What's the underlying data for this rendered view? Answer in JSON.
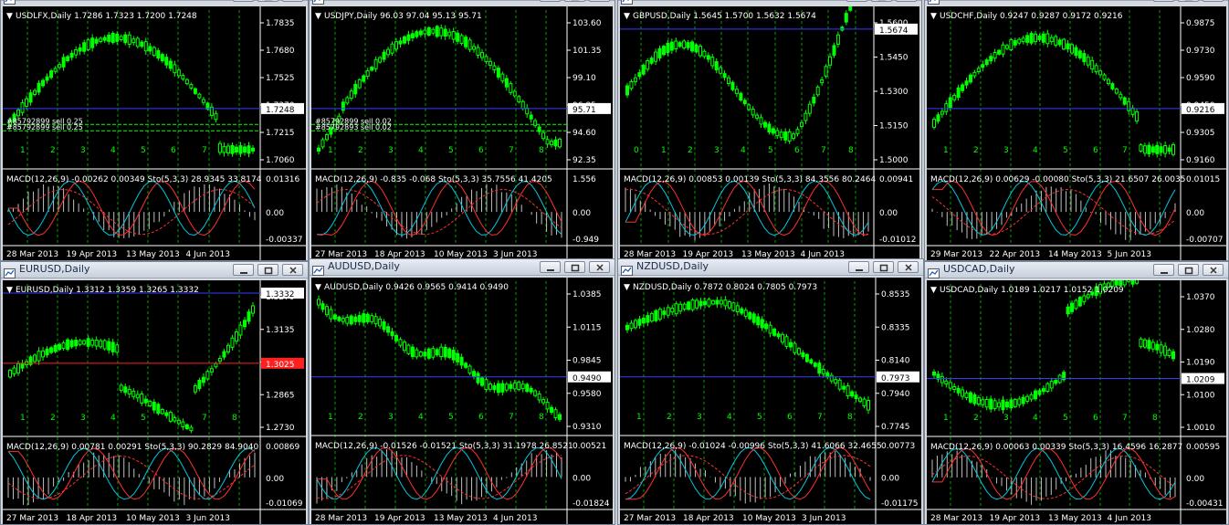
{
  "windows": [
    {
      "id": "usdlfx",
      "title": "USDLFX,Daily",
      "header": "USDLFX,Daily  1.7286 1.7323 1.7200 1.7248",
      "price_ticks": [
        "1.7835",
        "1.7680",
        "1.7525",
        "1.7370",
        "1.7215",
        "1.7060"
      ],
      "current_price": "1.7248",
      "order_lines": [
        "#85792899 sell 0.25",
        "#85792899 sell 0.25"
      ],
      "indicator_header": "MACD(12,26,9) -0.00262 0.00349  Sto(5,3,3) 28.9345 33.8174",
      "indicator_ticks": [
        "0.01316",
        "0.00",
        "-0.00337"
      ],
      "date_labels": [
        "28 Mar 2013",
        "19 Apr 2013",
        "13 May 2013",
        "4 Jun 2013"
      ],
      "week_labels": [
        "1",
        "2",
        "3",
        "4",
        "5",
        "6",
        "7",
        "8"
      ],
      "shape": "humpmid",
      "show_titlebar": false
    },
    {
      "id": "usdjpy",
      "title": "USDJPY,Daily",
      "header": "USDJPY,Daily  96.03 97.04 95.13 95.71",
      "price_ticks": [
        "103.60",
        "101.35",
        "99.10",
        "96.85",
        "94.60",
        "92.35"
      ],
      "current_price": "95.71",
      "order_lines": [
        "#85792899 sell 0.02",
        "#85792893 sell 0.02"
      ],
      "indicator_header": "MACD(12,26,9) -0.835 -0.068  Sto(5,3,3) 35.7556 41.4205",
      "indicator_ticks": [
        "1.556",
        "0.00",
        "-0.949"
      ],
      "date_labels": [
        "27 Mar 2013",
        "18 Apr 2013",
        "10 May 2013",
        "3 Jun 2013"
      ],
      "week_labels": [
        "1",
        "2",
        "3",
        "4",
        "5",
        "6",
        "7",
        "8"
      ],
      "shape": "risefall",
      "show_titlebar": false
    },
    {
      "id": "gbpusd",
      "title": "GBPUSD,Daily",
      "header": "GBPUSD,Daily  1.5645 1.5700 1.5632 1.5674",
      "price_ticks": [
        "1.5600",
        "1.5450",
        "1.5300",
        "1.5150",
        "1.5000"
      ],
      "current_price": "1.5674",
      "order_lines": [],
      "indicator_header": "MACD(12,26,9) 0.00853 0.00139  Sto(5,3,3) 84.3556 80.2464",
      "indicator_ticks": [
        "0.00941",
        "0.00",
        "-0.01012"
      ],
      "date_labels": [
        "28 Mar 2013",
        "19 Apr 2013",
        "13 May 2013",
        "4 Jun 2013"
      ],
      "week_labels": [
        "0",
        "1",
        "2",
        "3",
        "4",
        "5",
        "6",
        "7",
        "8"
      ],
      "shape": "wave_up",
      "show_titlebar": false
    },
    {
      "id": "usdchf",
      "title": "USDCHF,Daily",
      "header": "USDCHF,Daily  0.9247 0.9287 0.9172 0.9216",
      "price_ticks": [
        "0.9875",
        "0.9730",
        "0.9590",
        "0.9450",
        "0.9305",
        "0.9160"
      ],
      "current_price": "0.9216",
      "order_lines": [],
      "indicator_header": "MACD(12,26,9) 0.00629 -0.00080  Sto(5,3,3) 21.6507 26.0035",
      "indicator_ticks": [
        "0.01015",
        "0.00",
        "-0.00707"
      ],
      "date_labels": [
        "29 Mar 2013",
        "22 Apr 2013",
        "14 May 2013",
        "5 Jun 2013"
      ],
      "week_labels": [
        "1",
        "2",
        "3",
        "4",
        "5",
        "6",
        "7",
        "8"
      ],
      "shape": "humpmid",
      "show_titlebar": false
    },
    {
      "id": "eurusd",
      "title": "EURUSD,Daily",
      "header": "EURUSD,Daily  1.3312 1.3359 1.3265 1.3332",
      "price_ticks": [
        "1.3270",
        "1.3135",
        "1.3000",
        "1.2865",
        "1.2730"
      ],
      "current_price": "1.3332",
      "red_line": "1.3025",
      "order_lines": [],
      "indicator_header": "MACD(12,26,9) 0.00781 0.00291  Sto(5,3,3) 90.2829 84.9040",
      "indicator_ticks": [
        "0.00869",
        "0.00",
        "-0.01069"
      ],
      "date_labels": [
        "27 Mar 2013",
        "18 Apr 2013",
        "10 May 2013",
        "3 Jun 2013"
      ],
      "week_labels": [
        "1",
        "2",
        "3",
        "4",
        "5",
        "6",
        "7",
        "8"
      ],
      "shape": "dip_up",
      "show_titlebar": true
    },
    {
      "id": "audusd",
      "title": "AUDUSD,Daily",
      "header": "AUDUSD,Daily  0.9426 0.9565 0.9414 0.9490",
      "price_ticks": [
        "1.0385",
        "1.0115",
        "0.9845",
        "0.9580",
        "0.9310"
      ],
      "current_price": "0.9490",
      "order_lines": [],
      "indicator_header": "MACD(12,26,9) -0.01526 -0.01521  Sto(5,3,3) 31.1978 26.8521",
      "indicator_ticks": [
        "0.00521",
        "0.00",
        "-0.01824"
      ],
      "date_labels": [
        "28 Mar 2013",
        "19 Apr 2013",
        "13 May 2013",
        "4 Jun 2013"
      ],
      "week_labels": [
        "1",
        "2",
        "3",
        "4",
        "5",
        "6",
        "7",
        "8"
      ],
      "shape": "down",
      "show_titlebar": true
    },
    {
      "id": "nzdusd",
      "title": "NZDUSD,Daily",
      "header": "NZDUSD,Daily  0.7872 0.8024 0.7805 0.7973",
      "price_ticks": [
        "0.8535",
        "0.8335",
        "0.8140",
        "0.7940",
        "0.7745"
      ],
      "current_price": "0.7973",
      "order_lines": [],
      "indicator_header": "MACD(12,26,9) -0.01024 -0.00996  Sto(5,3,3) 41.6066 32.4655",
      "indicator_ticks": [
        "0.00773",
        "0.00",
        "-0.01175"
      ],
      "date_labels": [
        "27 Mar 2013",
        "18 Apr 2013",
        "10 May 2013",
        "3 Jun 2013"
      ],
      "week_labels": [
        "1",
        "2",
        "3",
        "4",
        "5",
        "6",
        "7",
        "8"
      ],
      "shape": "down2",
      "show_titlebar": true
    },
    {
      "id": "usdcad",
      "title": "USDCAD,Daily",
      "header": "USDCAD,Daily  1.0189 1.0217 1.0152 1.0209",
      "price_ticks": [
        "1.0370",
        "1.0280",
        "1.0190",
        "1.0100",
        "1.0010"
      ],
      "current_price": "1.0209",
      "order_lines": [],
      "indicator_header": "MACD(12,26,9) 0.00063 0.00339  Sto(5,3,3) 16.4596 16.2877",
      "indicator_ticks": [
        "0.00595",
        "0.00",
        "-0.00431"
      ],
      "date_labels": [
        "28 Mar 2013",
        "19 Apr 2013",
        "13 May 2013",
        "4 Jun 2013"
      ],
      "week_labels": [
        "1",
        "2",
        "3",
        "4",
        "5",
        "6",
        "7",
        "8"
      ],
      "shape": "dip_hump",
      "show_titlebar": true
    }
  ],
  "colors": {
    "candle": "#00ff00",
    "grid": "#00a000",
    "chart_bg": "#000000",
    "text": "#ffffff",
    "price_line": "#3a3aff",
    "red_line": "#ff2020",
    "macd_hist": "#c0c0c0",
    "macd_signal": "#ff3030",
    "sto_main": "#00c8e0"
  }
}
